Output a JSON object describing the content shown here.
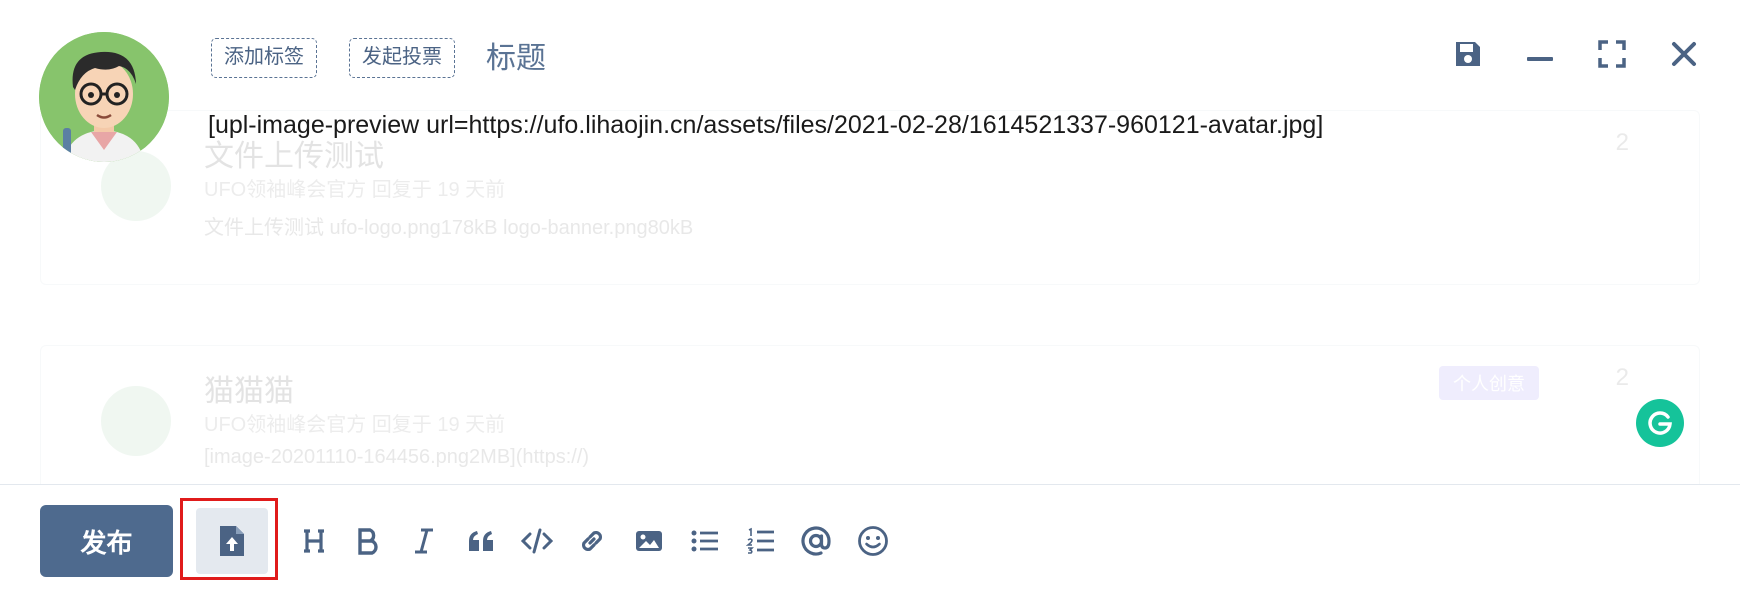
{
  "background": {
    "cards": [
      {
        "title": "文件上传测试",
        "meta": "UFO领袖峰会官方 回复于 19 天前",
        "excerpt": "文件上传测试 ufo-logo.png178kB logo-banner.png80kB",
        "tag": "",
        "comments": "2"
      },
      {
        "title": "猫猫猫",
        "meta": "UFO领袖峰会官方 回复于 19 天前",
        "excerpt": "[image-20201110-164456.png2MB](https://)",
        "tag": "个人创意",
        "comments": "2"
      }
    ]
  },
  "composer": {
    "add_tag_label": "添加标签",
    "start_vote_label": "发起投票",
    "title_placeholder": "标题",
    "body_text": "[upl-image-preview url=https://ufo.lihaojin.cn/assets/files/2021-02-28/1614521337-960121-avatar.jpg]",
    "window_controls": [
      "save-icon",
      "minimize-icon",
      "fullscreen-icon",
      "close-icon"
    ]
  },
  "toolbar": {
    "publish_label": "发布",
    "upload_icon": "file-upload-icon",
    "tools": [
      "heading-icon",
      "bold-icon",
      "italic-icon",
      "quote-icon",
      "code-icon",
      "link-icon",
      "image-icon",
      "bullet-list-icon",
      "numbered-list-icon",
      "mention-icon",
      "emoji-icon"
    ]
  },
  "colors": {
    "primary": "#4e6a8e",
    "icon": "#4b6384",
    "highlight_box": "#e01b1b",
    "grammarly": "#15c39a",
    "avatar_bg": "#87c46c"
  }
}
